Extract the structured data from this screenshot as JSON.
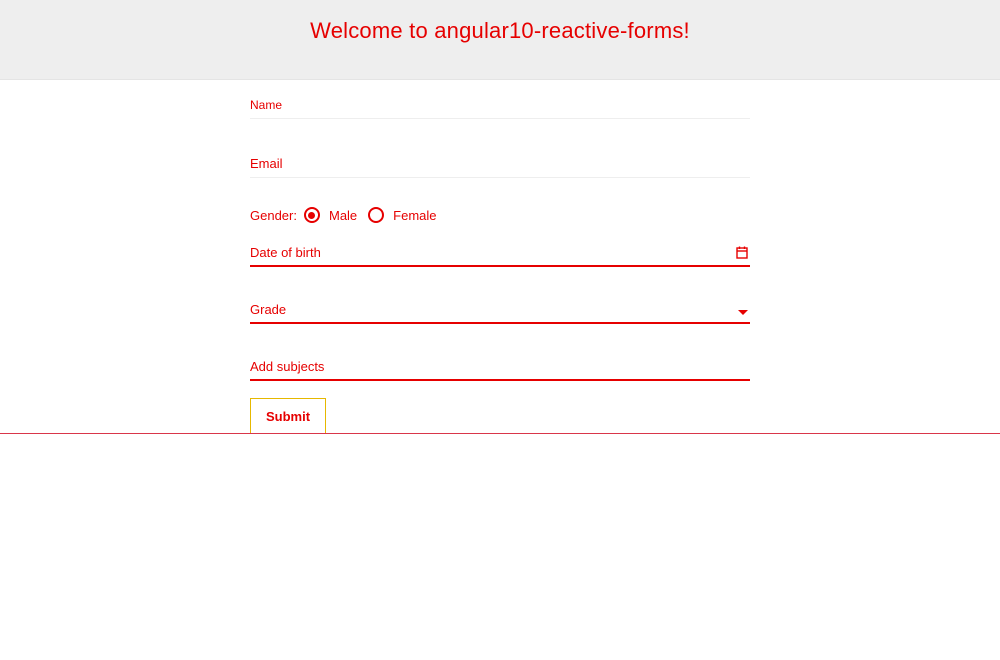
{
  "header": {
    "title": "Welcome to angular10-reactive-forms!"
  },
  "form": {
    "name_label": "Name",
    "email_label": "Email",
    "gender": {
      "label": "Gender:",
      "options": [
        {
          "label": "Male",
          "checked": true
        },
        {
          "label": "Female",
          "checked": false
        }
      ]
    },
    "dob_label": "Date of birth",
    "grade_label": "Grade",
    "subjects_label": "Add subjects",
    "submit_label": "Submit"
  },
  "icons": {
    "datepicker": "calendar-icon",
    "grade_dropdown": "chevron-down-icon"
  },
  "colors": {
    "accent": "#e60000",
    "banner_bg": "#eeeeee"
  }
}
